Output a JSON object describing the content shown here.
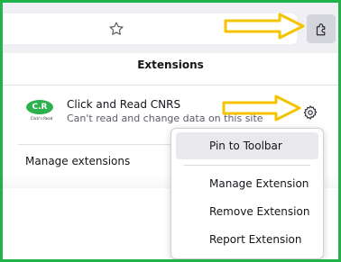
{
  "toolbar": {
    "bookmark_icon": "star-icon",
    "extensions_icon": "puzzle-icon"
  },
  "panel": {
    "title": "Extensions",
    "extension": {
      "name": "Click and Read CNRS",
      "permission": "Can't read and change data on this site",
      "logo_text": "C.R",
      "logo_caption": "Click'n Read",
      "settings_icon": "gear-icon"
    },
    "manage_label": "Manage extensions"
  },
  "context_menu": {
    "items": [
      {
        "label": "Pin to Toolbar"
      },
      {
        "label": "Manage Extension"
      },
      {
        "label": "Remove Extension"
      },
      {
        "label": "Report Extension"
      }
    ],
    "highlighted_index": 0
  },
  "annotations": {
    "arrow_color": "#f5c400",
    "frame_color": "#1fb34a"
  }
}
